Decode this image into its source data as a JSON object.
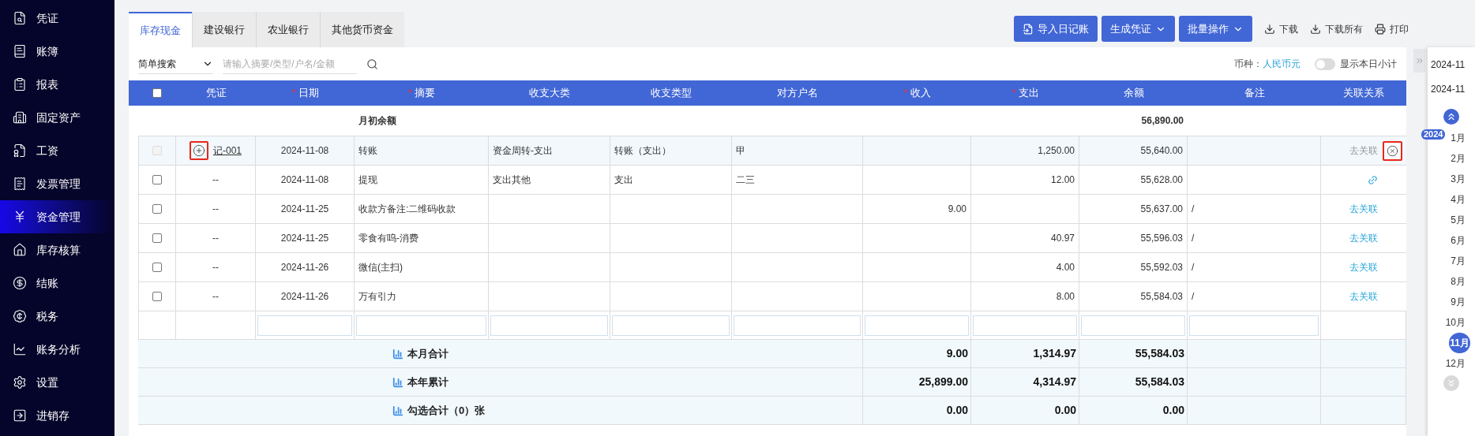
{
  "sidebar": {
    "items": [
      {
        "label": "凭证",
        "selected": false
      },
      {
        "label": "账簿",
        "selected": false
      },
      {
        "label": "报表",
        "selected": false
      },
      {
        "label": "固定资产",
        "selected": false
      },
      {
        "label": "工资",
        "selected": false
      },
      {
        "label": "发票管理",
        "selected": false
      },
      {
        "label": "资金管理",
        "selected": true
      },
      {
        "label": "库存核算",
        "selected": false
      },
      {
        "label": "结账",
        "selected": false
      },
      {
        "label": "税务",
        "selected": false
      },
      {
        "label": "账务分析",
        "selected": false
      },
      {
        "label": "设置",
        "selected": false
      },
      {
        "label": "进销存",
        "selected": false
      }
    ]
  },
  "tabs": [
    {
      "label": "库存现金",
      "selected": true
    },
    {
      "label": "建设银行",
      "selected": false
    },
    {
      "label": "农业银行",
      "selected": false
    },
    {
      "label": "其他货币资金",
      "selected": false
    }
  ],
  "toolbar": {
    "buttons": [
      {
        "label": "导入日记账",
        "kind": "import"
      },
      {
        "label": "生成凭证",
        "kind": "dropdown"
      },
      {
        "label": "批量操作",
        "kind": "dropdown"
      }
    ],
    "links": [
      {
        "label": "下载",
        "kind": "download"
      },
      {
        "label": "下载所有",
        "kind": "download"
      },
      {
        "label": "打印",
        "kind": "print"
      }
    ]
  },
  "search": {
    "mode": "简单搜索",
    "placeholder": "请输入摘要/类型/户名/金额"
  },
  "currency": {
    "label": "币种：",
    "value": "人民币元"
  },
  "toggle": {
    "label": "显示本日小计",
    "on": false
  },
  "table": {
    "select_all": {
      "checked": false
    },
    "columns": [
      {
        "label": "凭证"
      },
      {
        "label": "日期",
        "marker": "*"
      },
      {
        "label": "摘要",
        "marker": "*"
      },
      {
        "label": "收支大类"
      },
      {
        "label": "收支类型"
      },
      {
        "label": "对方户名"
      },
      {
        "label": "收入",
        "marker": "*"
      },
      {
        "label": "支出",
        "marker": "*"
      },
      {
        "label": "余额"
      },
      {
        "label": "备注"
      },
      {
        "label": "关联关系"
      }
    ],
    "opening_row": {
      "label": "月初余额",
      "balance": "56,890.00"
    },
    "rows": [
      {
        "selected": true,
        "checked": false,
        "disabled": true,
        "expandable": true,
        "voucher": "记-001",
        "date": "2024-11-08",
        "summary": "转账",
        "category": "资金周转-支出",
        "type": "转账（支出）",
        "counterparty": "甲",
        "income": "",
        "expense": "1,250.00",
        "balance": "55,640.00",
        "note": "",
        "relation": {
          "kind": "unlink_disabled",
          "label": "去关联"
        }
      },
      {
        "selected": false,
        "checked": false,
        "disabled": false,
        "expandable": false,
        "voucher": "--",
        "date": "2024-11-08",
        "summary": "提现",
        "category": "支出其他",
        "type": "支出",
        "counterparty": "二三",
        "income": "",
        "expense": "12.00",
        "balance": "55,628.00",
        "note": "",
        "relation": {
          "kind": "link_icon"
        }
      },
      {
        "selected": false,
        "checked": false,
        "disabled": false,
        "expandable": false,
        "voucher": "--",
        "date": "2024-11-25",
        "summary": "收款方备注:二维码收款",
        "category": "",
        "type": "",
        "counterparty": "",
        "income": "9.00",
        "expense": "",
        "balance": "55,637.00",
        "note": "/",
        "relation": {
          "kind": "unlink",
          "label": "去关联"
        }
      },
      {
        "selected": false,
        "checked": false,
        "disabled": false,
        "expandable": false,
        "voucher": "--",
        "date": "2024-11-25",
        "summary": "零食有呜-消费",
        "category": "",
        "type": "",
        "counterparty": "",
        "income": "",
        "expense": "40.97",
        "balance": "55,596.03",
        "note": "/",
        "relation": {
          "kind": "unlink",
          "label": "去关联"
        }
      },
      {
        "selected": false,
        "checked": false,
        "disabled": false,
        "expandable": false,
        "voucher": "--",
        "date": "2024-11-26",
        "summary": "微信(主扫)",
        "category": "",
        "type": "",
        "counterparty": "",
        "income": "",
        "expense": "4.00",
        "balance": "55,592.03",
        "note": "/",
        "relation": {
          "kind": "unlink",
          "label": "去关联"
        }
      },
      {
        "selected": false,
        "checked": false,
        "disabled": false,
        "expandable": false,
        "voucher": "--",
        "date": "2024-11-26",
        "summary": "万有引力",
        "category": "",
        "type": "",
        "counterparty": "",
        "income": "",
        "expense": "8.00",
        "balance": "55,584.03",
        "note": "/",
        "relation": {
          "kind": "unlink",
          "label": "去关联"
        }
      }
    ],
    "totals": [
      {
        "label": "本月合计",
        "income": "9.00",
        "expense": "1,314.97",
        "balance": "55,584.03"
      },
      {
        "label": "本年累计",
        "income": "25,899.00",
        "expense": "4,314.97",
        "balance": "55,584.03"
      },
      {
        "label": "勾选合计（0）张",
        "income": "0.00",
        "expense": "0.00",
        "balance": "0.00"
      }
    ]
  },
  "period_panel": {
    "dates": [
      "2024-11",
      "2024-11"
    ],
    "year": "2024",
    "months": [
      {
        "label": "1月",
        "selected": false
      },
      {
        "label": "2月",
        "selected": false
      },
      {
        "label": "3月",
        "selected": false
      },
      {
        "label": "4月",
        "selected": false
      },
      {
        "label": "5月",
        "selected": false
      },
      {
        "label": "6月",
        "selected": false
      },
      {
        "label": "7月",
        "selected": false
      },
      {
        "label": "8月",
        "selected": false
      },
      {
        "label": "9月",
        "selected": false
      },
      {
        "label": "10月",
        "selected": false
      },
      {
        "label": "11月",
        "selected": true
      },
      {
        "label": "12月",
        "selected": false
      }
    ]
  }
}
